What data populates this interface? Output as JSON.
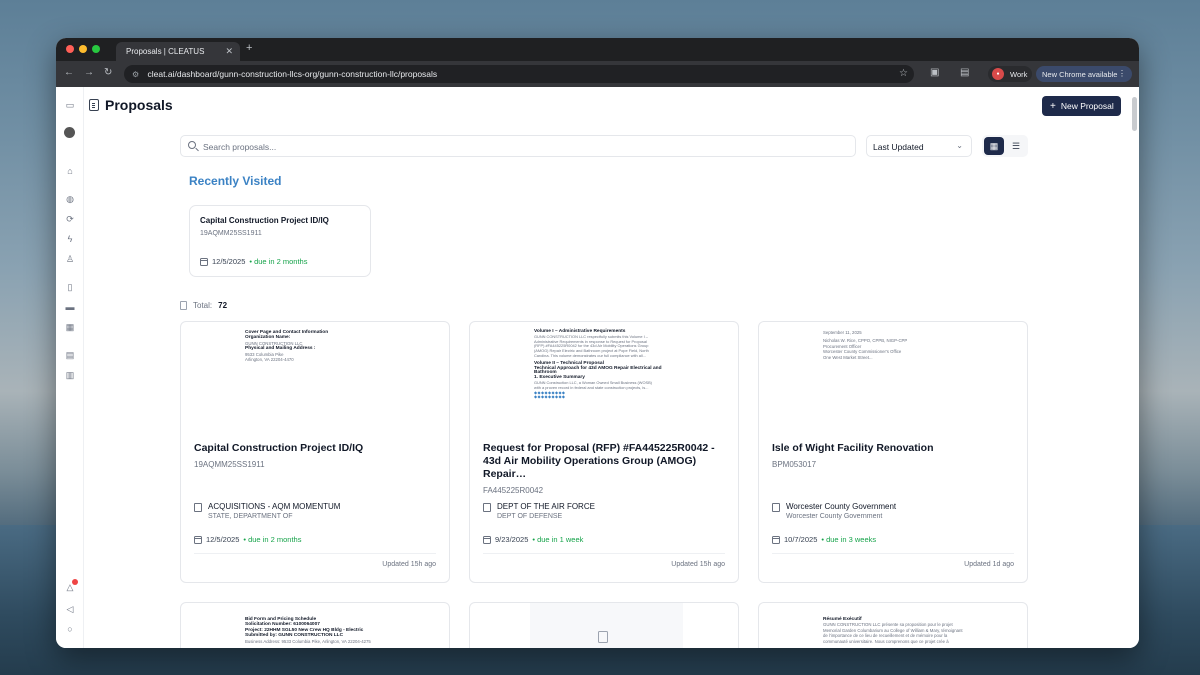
{
  "browser": {
    "tab_title": "Proposals | CLEATUS",
    "url": "cleat.ai/dashboard/gunn-construction-llcs-org/gunn-construction-llc/proposals",
    "profile_label": "Work",
    "update_label": "New Chrome available"
  },
  "header": {
    "title": "Proposals",
    "new_button": "New Proposal"
  },
  "toolbar": {
    "search_placeholder": "Search proposals...",
    "sort_value": "Last Updated"
  },
  "recent": {
    "heading": "Recently Visited",
    "card": {
      "title": "Capital Construction Project ID/IQ",
      "id": "19AQMM25SS1911",
      "date": "12/5/2025",
      "due": "due in 2 months"
    }
  },
  "total": {
    "label": "Total:",
    "count": "72"
  },
  "cards": [
    {
      "title": "Capital Construction Project ID/IQ",
      "id": "19AQMM25SS1911",
      "agency": "ACQUISITIONS - AQM MOMENTUM",
      "agency_sub": "STATE, DEPARTMENT OF",
      "date": "12/5/2025",
      "due": "due in 2 months",
      "updated": "Updated 15h ago",
      "preview": [
        "Cover Page and Contact Information",
        "Organization Name:",
        "GUNN CONSTRUCTION LLC",
        "Physical and Mailing Address :",
        "9533 Columbia Pike",
        "Arlington, VA 22204-4470"
      ]
    },
    {
      "title": "Request for Proposal (RFP) #FA445225R0042 - 43d Air Mobility Operations Group (AMOG) Repair…",
      "id": "FA445225R0042",
      "agency": "DEPT OF THE AIR FORCE",
      "agency_sub": "DEPT OF DEFENSE",
      "date": "9/23/2025",
      "due": "due in 1 week",
      "updated": "Updated 15h ago",
      "preview": [
        "Volume I – Administrative Requirements",
        "GUNN CONSTRUCTION LLC respectfully submits this Volume I –",
        "Administrative Requirements in response to Request for Proposal",
        "(RFP) #FA445225R0042 for the 43d Air Mobility Operations Group",
        "(AMOG) Repair Electric and Bathroom project at Pope Field, North",
        "Carolina. This volume demonstrates our full compliance with all...",
        "Volume II – Technical Proposal",
        "Technical Approach for 43d AMOG Repair Electrical and",
        "Bathroom",
        "1. Executive Summary",
        "GUNN Construction LLC, a Woman Owned Small Business (WOSB)",
        "with a proven record in federal and state construction projects, is..."
      ]
    },
    {
      "title": "Isle of Wight Facility Renovation",
      "id": "BPM053017",
      "agency": "Worcester County Government",
      "agency_sub": "Worcester County Government",
      "date": "10/7/2025",
      "due": "due in 3 weeks",
      "updated": "Updated 1d ago",
      "preview": [
        "September 11, 2025",
        "Nicholas W. Rice, CPPO, CPPB, NIGP-CPP",
        "Procurement Officer",
        "Worcester County Commissioner's Office",
        "One West Market Street..."
      ]
    }
  ],
  "cards_row2": [
    {
      "preview": [
        "Bid Form and Pricing Schedule",
        "Solicitation Number: 6100064007",
        "Project: 22HHM SGL50 New Crew HQ Bldg - Electric",
        "Submitted by: GUNN CONSTRUCTION LLC",
        "Business Address: 9533 Columbia Pike, Arlington, VA 22204-4275"
      ]
    },
    {
      "preview": []
    },
    {
      "preview": [
        "Résumé Exécutif",
        "GUNN CONSTRUCTION LLC présente sa proposition pour le projet",
        "Memorial Garden Columbarium au College of William & Mary, témoignant",
        "de l'importance de ce lieu de recueillement et de mémoire pour la",
        "communauté universitaire. Nous comprenons que ce projet crée à"
      ]
    }
  ],
  "colors": {
    "accent": "#1e2a4a",
    "link": "#3b82c4",
    "due": "#16a34a",
    "notification": "#ef4444"
  }
}
